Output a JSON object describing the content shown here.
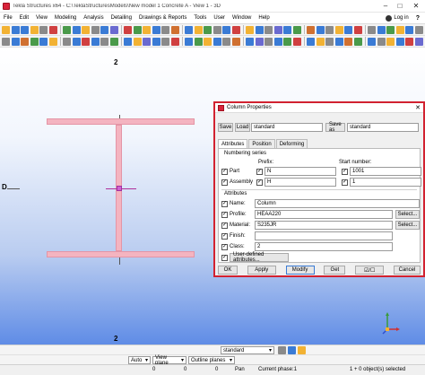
{
  "window": {
    "title": "Tekla Structures x64 - C:\\TeklaStructuresModels\\New model 1 Concrete A - View 1 - 3D",
    "icon": "tekla-app-icon",
    "controls": [
      "–",
      "□",
      "✕"
    ]
  },
  "menubar": {
    "items": [
      "File",
      "Edit",
      "View",
      "Modeling",
      "Analysis",
      "Detailing",
      "Drawings & Reports",
      "Tools",
      "User",
      "Window",
      "Help"
    ],
    "login_label": "Log in",
    "help_symbol": "?"
  },
  "toolbar_colors": {
    "row1": [
      "#f2b233",
      "#3a7bd5",
      "#3a7bd5",
      "#f2b233",
      "#8a8a8a",
      "#d04040",
      "#4a9a4a",
      "#3a7bd5",
      "#f2b233",
      "#8a8a8a",
      "#3a7bd5",
      "#6a6ad0",
      "#d04040",
      "#4a9a4a",
      "#f2b233",
      "#3a7bd5",
      "#8a8a8a",
      "#d07030",
      "#3a7bd5",
      "#f2b233",
      "#4a9a4a",
      "#8a8a8a",
      "#3a7bd5",
      "#d04040",
      "#f2b233",
      "#3a7bd5",
      "#8a8a8a",
      "#6a6ad0",
      "#3a7bd5",
      "#4a9a4a",
      "#d07030",
      "#3a7bd5",
      "#8a8a8a",
      "#f2b233",
      "#3a7bd5",
      "#d04040",
      "#8a8a8a",
      "#3a7bd5",
      "#4a9a4a",
      "#f2b233",
      "#3a7bd5",
      "#8a8a8a",
      "#d04040",
      "#3a7bd5",
      "#6a6ad0"
    ],
    "row2": [
      "#8a8a8a",
      "#3a7bd5",
      "#d07030",
      "#4a9a4a",
      "#3a7bd5",
      "#f2b233",
      "#8a8a8a",
      "#3a7bd5",
      "#d04040",
      "#3a7bd5",
      "#8a8a8a",
      "#4a9a4a",
      "#3a7bd5",
      "#f2b233",
      "#6a6ad0",
      "#3a7bd5",
      "#8a8a8a",
      "#d04040",
      "#3a7bd5",
      "#4a9a4a",
      "#f2b233",
      "#3a7bd5",
      "#8a8a8a",
      "#d07030",
      "#3a7bd5",
      "#6a6ad0",
      "#8a8a8a",
      "#3a7bd5",
      "#4a9a4a",
      "#d04040",
      "#3a7bd5",
      "#f2b233",
      "#8a8a8a",
      "#3a7bd5",
      "#d07030",
      "#4a9a4a",
      "#3a7bd5",
      "#8a8a8a",
      "#f2b233",
      "#3a7bd5",
      "#d04040",
      "#6a6ad0",
      "#3a7bd5",
      "#8a8a8a",
      "#4a9a4a"
    ]
  },
  "viewport": {
    "grid_label_top": "2",
    "grid_label_bottom": "2",
    "grid_label_left": "D",
    "beam_color": "#f4b4c0"
  },
  "dialog": {
    "title": "Column Properties",
    "save_label": "Save",
    "load_label": "Load",
    "load_value": "standard",
    "save_as_label": "Save as",
    "save_as_value": "standard",
    "tabs": [
      "Attributes",
      "Position",
      "Deforming"
    ],
    "numbering_series_label": "Numbering series",
    "prefix_label": "Prefix:",
    "start_number_label": "Start number:",
    "part_label": "Part",
    "part_prefix": "N",
    "part_start": "1001",
    "assembly_label": "Assembly",
    "assembly_prefix": "H",
    "assembly_start": "1",
    "attributes_label": "Attributes",
    "name_label": "Name:",
    "name_value": "Column",
    "profile_label": "Profile:",
    "profile_value": "HEAA220",
    "material_label": "Material:",
    "material_value": "S235JR",
    "finish_label": "Finish:",
    "finish_value": "",
    "class_label": "Class:",
    "class_value": "2",
    "select_label": "Select...",
    "uda_label": "User-defined attributes...",
    "ok_label": "OK",
    "apply_label": "Apply",
    "modify_label": "Modify",
    "get_label": "Get",
    "toggle_label": "☑/☐",
    "cancel_label": "Cancel",
    "check_mark": "✓"
  },
  "statusbar": {
    "row1_select": "standard",
    "auto_label": "Auto",
    "view_plane_label": "View plane",
    "outline_planes_label": "Outline planes",
    "coord_x": "0",
    "coord_y": "0",
    "coord_z": "0",
    "pan_label": "Pan",
    "current_phase": "Current phase:1",
    "selection_info": "1 + 0 object(s) selected"
  }
}
